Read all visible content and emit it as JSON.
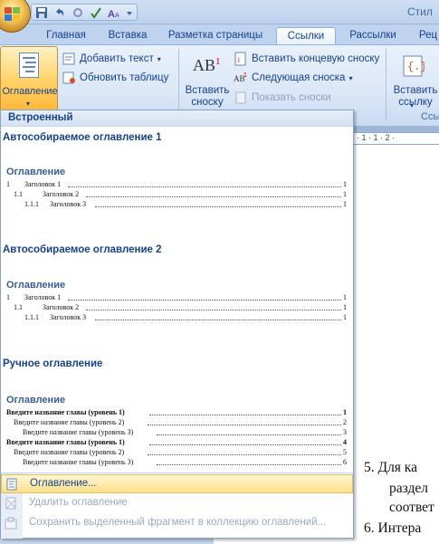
{
  "window": {
    "title_fragment": "Стил"
  },
  "tabs": [
    {
      "label": "Главная",
      "active": false
    },
    {
      "label": "Вставка",
      "active": false
    },
    {
      "label": "Разметка страницы",
      "active": false
    },
    {
      "label": "Ссылки",
      "active": true
    },
    {
      "label": "Рассылки",
      "active": false
    },
    {
      "label": "Рец",
      "active": false
    }
  ],
  "ribbon": {
    "toc_button": {
      "label": "Оглавление",
      "icon": "table-of-contents-icon"
    },
    "add_text": "Добавить текст",
    "update_table": "Обновить таблицу",
    "insert_footnote": "Вставить сноску",
    "insert_endnote": "Вставить концевую сноску",
    "next_footnote": "Следующая сноска",
    "show_notes": "Показать сноски",
    "insert_citation": "Вставить ссылку",
    "group_fragment": "Ссы"
  },
  "gallery": {
    "header": "Встроенный",
    "items": [
      {
        "title": "Автособираемое оглавление 1",
        "heading": "Оглавление",
        "lines": [
          {
            "num": "1",
            "text": "Заголовок 1",
            "page": "1",
            "bold": false
          },
          {
            "num": "1.1",
            "text": "Заголовок 2",
            "page": "1",
            "bold": false
          },
          {
            "num": "1.1.1",
            "text": "Заголовок 3",
            "page": "1",
            "bold": false
          }
        ]
      },
      {
        "title": "Автособираемое оглавление 2",
        "heading": "Оглавление",
        "lines": [
          {
            "num": "1",
            "text": "Заголовок 1",
            "page": "1",
            "bold": false
          },
          {
            "num": "1.1",
            "text": "Заголовок 2",
            "page": "1",
            "bold": false
          },
          {
            "num": "1.1.1",
            "text": "Заголовок 3",
            "page": "1",
            "bold": false
          }
        ]
      },
      {
        "title": "Ручное оглавление",
        "heading": "Оглавление",
        "lines": [
          {
            "num": "",
            "text": "Введите название главы (уровень 1)",
            "page": "1",
            "bold": true
          },
          {
            "num": "",
            "text": "Введите название главы (уровень 2)",
            "page": "2",
            "bold": false
          },
          {
            "num": "",
            "text": "Введите название главы (уровень 3)",
            "page": "3",
            "bold": false
          },
          {
            "num": "",
            "text": "Введите название главы (уровень 1)",
            "page": "4",
            "bold": true
          },
          {
            "num": "",
            "text": "Введите название главы (уровень 2)",
            "page": "5",
            "bold": false
          },
          {
            "num": "",
            "text": "Введите название главы (уровень 3)",
            "page": "6",
            "bold": false
          }
        ]
      }
    ],
    "menu": [
      {
        "label": "Оглавление...",
        "highlighted": true,
        "disabled": false
      },
      {
        "label": "Удалить оглавление",
        "highlighted": false,
        "disabled": true
      },
      {
        "label": "Сохранить выделенный фрагмент в коллекцию оглавлений...",
        "highlighted": false,
        "disabled": true
      }
    ]
  },
  "ruler": {
    "text": "· 1 · 1 · 2 ·"
  },
  "document": {
    "lines": [
      "5.  Для ка",
      "раздел",
      "соответ",
      "6.  Интера"
    ]
  },
  "colors": {
    "accent": "#15428b",
    "highlight": "#ffe08a",
    "heading": "#365f91"
  }
}
